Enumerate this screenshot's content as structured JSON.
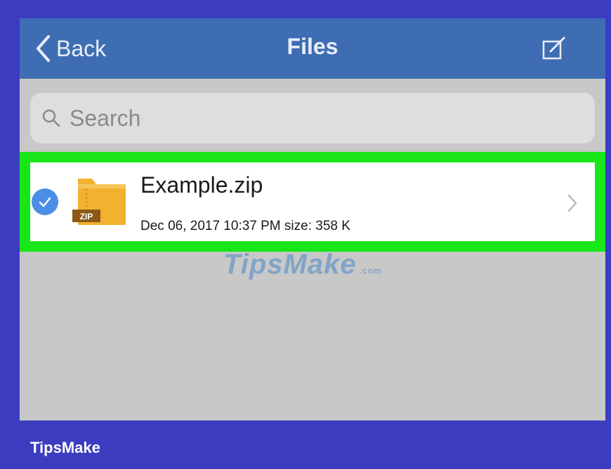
{
  "header": {
    "back_label": "Back",
    "title": "Files"
  },
  "search": {
    "placeholder": "Search"
  },
  "files": [
    {
      "name": "Example.zip",
      "badge": "ZIP",
      "meta": "Dec 06, 2017 10:37 PM  size: 358 K",
      "selected": true
    }
  ],
  "watermark": {
    "text": "TipsMake",
    "suffix": ".com"
  },
  "brand": "TipsMake",
  "colors": {
    "background": "#3c3cc0",
    "navbar": "#3f6db3",
    "highlight": "#19e619",
    "check": "#4a8ee6",
    "folder": "#f2b12e"
  },
  "icons": [
    "back-chevron-icon",
    "compose-icon",
    "search-icon",
    "checkmark-icon",
    "zip-folder-icon",
    "chevron-right-icon"
  ]
}
